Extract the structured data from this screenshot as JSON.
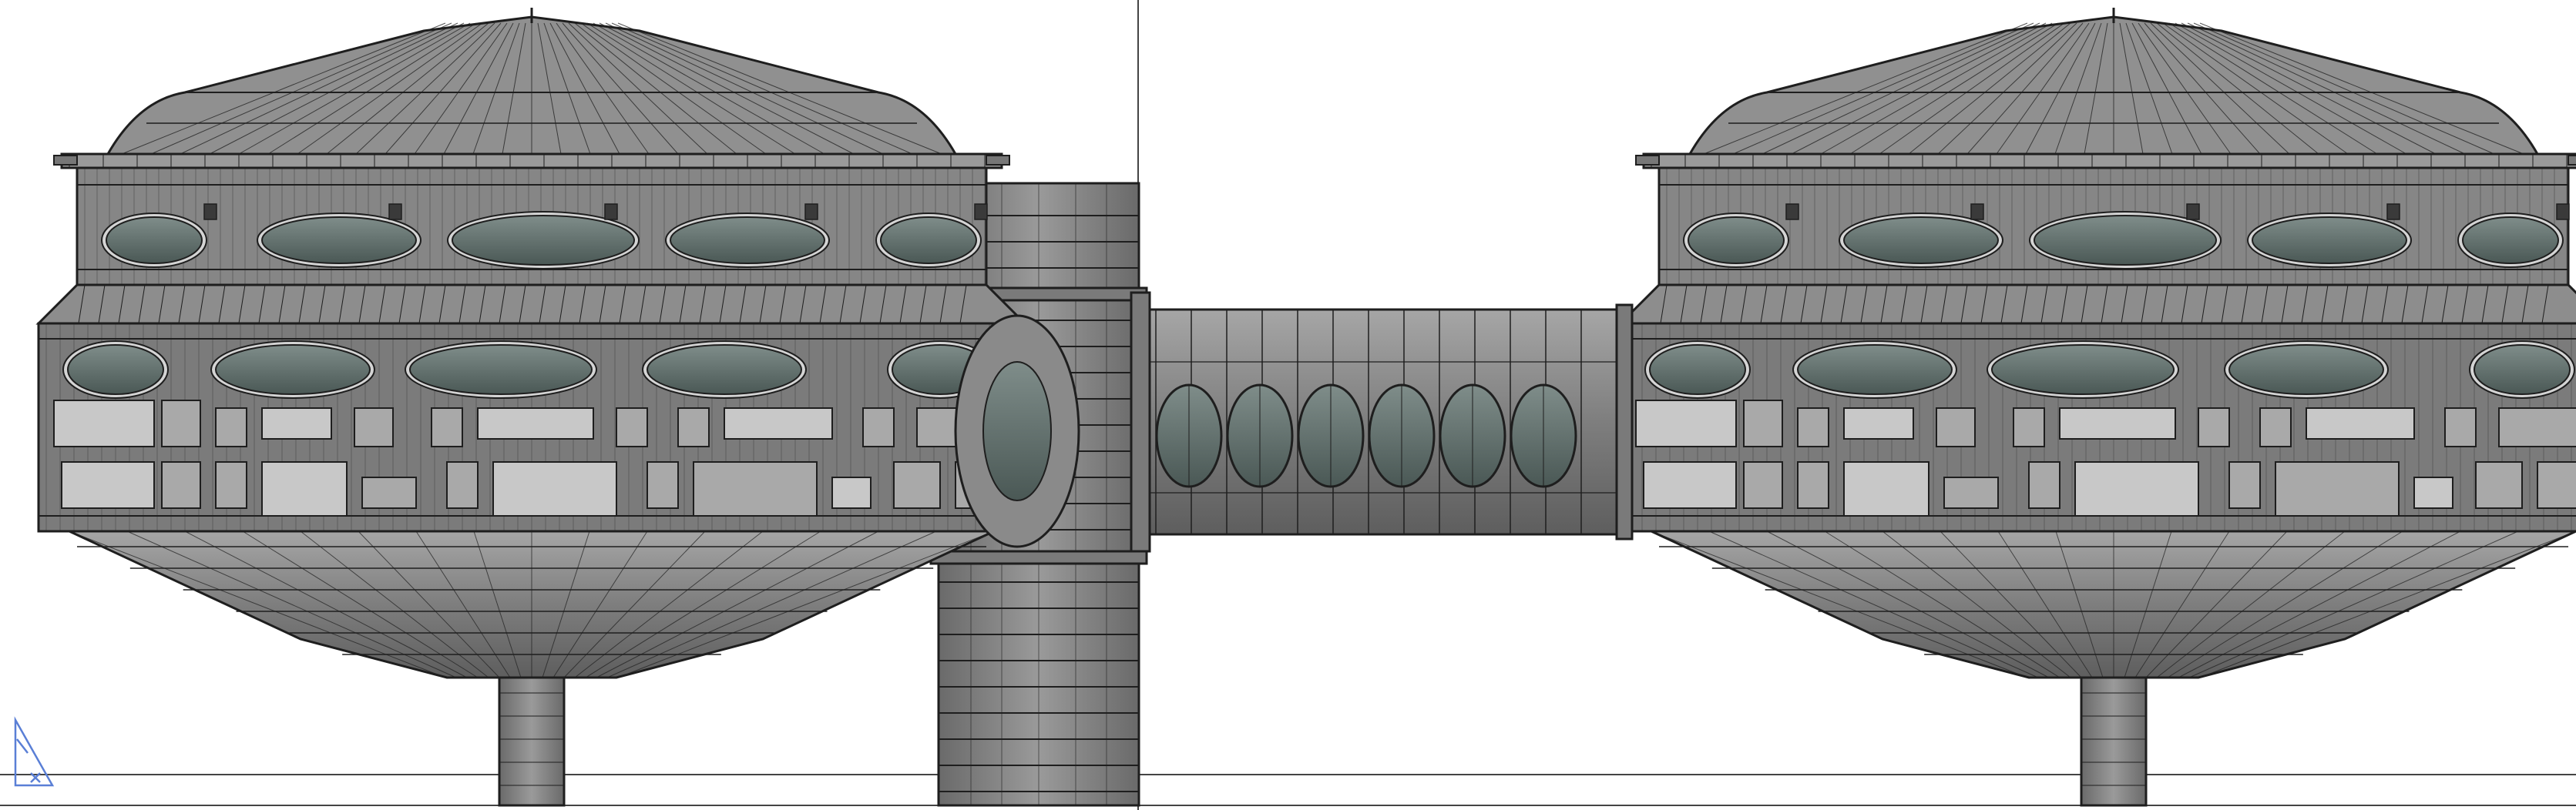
{
  "viewport": {
    "name": "front-view-viewport",
    "background": "#ffffff",
    "guide_color": "#444444",
    "axis_gizmo_color": "#5a7fd6"
  },
  "model": {
    "hull_light": "#9a9a9a",
    "hull_mid": "#7d7d7d",
    "hull_dark": "#5a5a5a",
    "wire": "#1e1e1e",
    "window_glass": "#5f6e6b",
    "window_rim": "#d4d4d4",
    "panel_light": "#c8c8c8",
    "pod_count": 2,
    "corridor_window_count": 6
  }
}
